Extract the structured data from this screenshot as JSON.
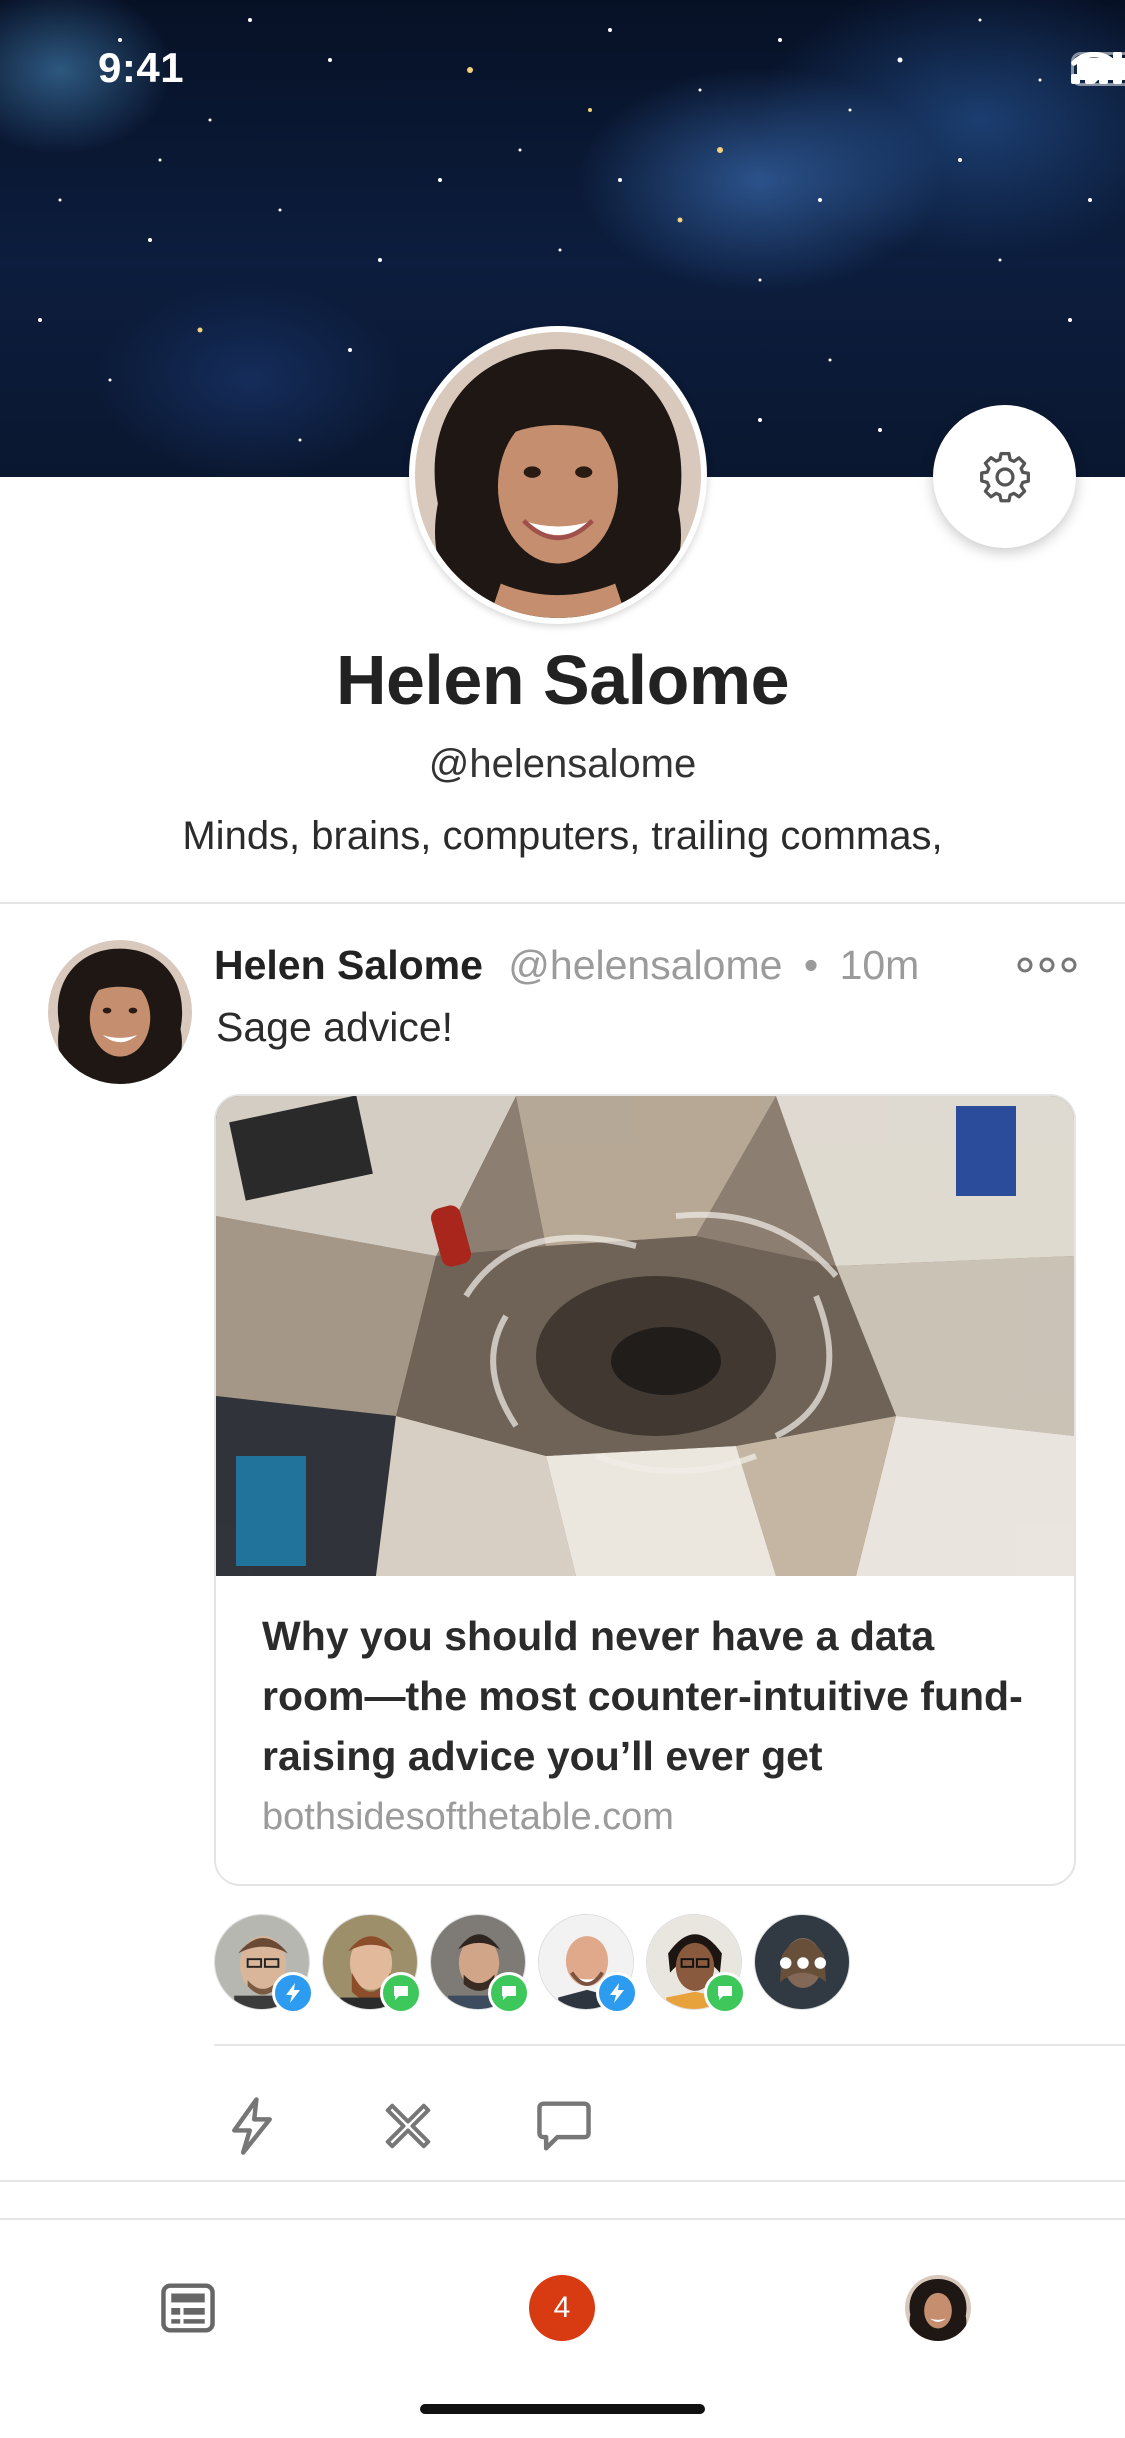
{
  "status_bar": {
    "time": "9:41"
  },
  "profile": {
    "name": "Helen Salome",
    "handle": "@helensalome",
    "bio": "Minds, brains, computers, trailing commas,"
  },
  "post": {
    "author": "Helen Salome",
    "handle": "@helensalome",
    "separator": "•",
    "time": "10m",
    "text": "Sage advice!",
    "link": {
      "title": "Why you should never have a data room—the most counter-intuitive fund-raising advice you’ll ever get",
      "domain": "bothsidesofthetable.com"
    },
    "reactions": [
      {
        "type": "bolt"
      },
      {
        "type": "chat"
      },
      {
        "type": "chat"
      },
      {
        "type": "bolt"
      },
      {
        "type": "chat"
      },
      {
        "type": "more"
      }
    ],
    "actions": [
      "bolt-icon",
      "cross-icon",
      "comment-icon"
    ]
  },
  "tabbar": {
    "notifications_count": "4"
  },
  "colors": {
    "accent_red": "#d83a12",
    "bolt_blue": "#2d9cf0",
    "chat_green": "#3ec75a"
  }
}
